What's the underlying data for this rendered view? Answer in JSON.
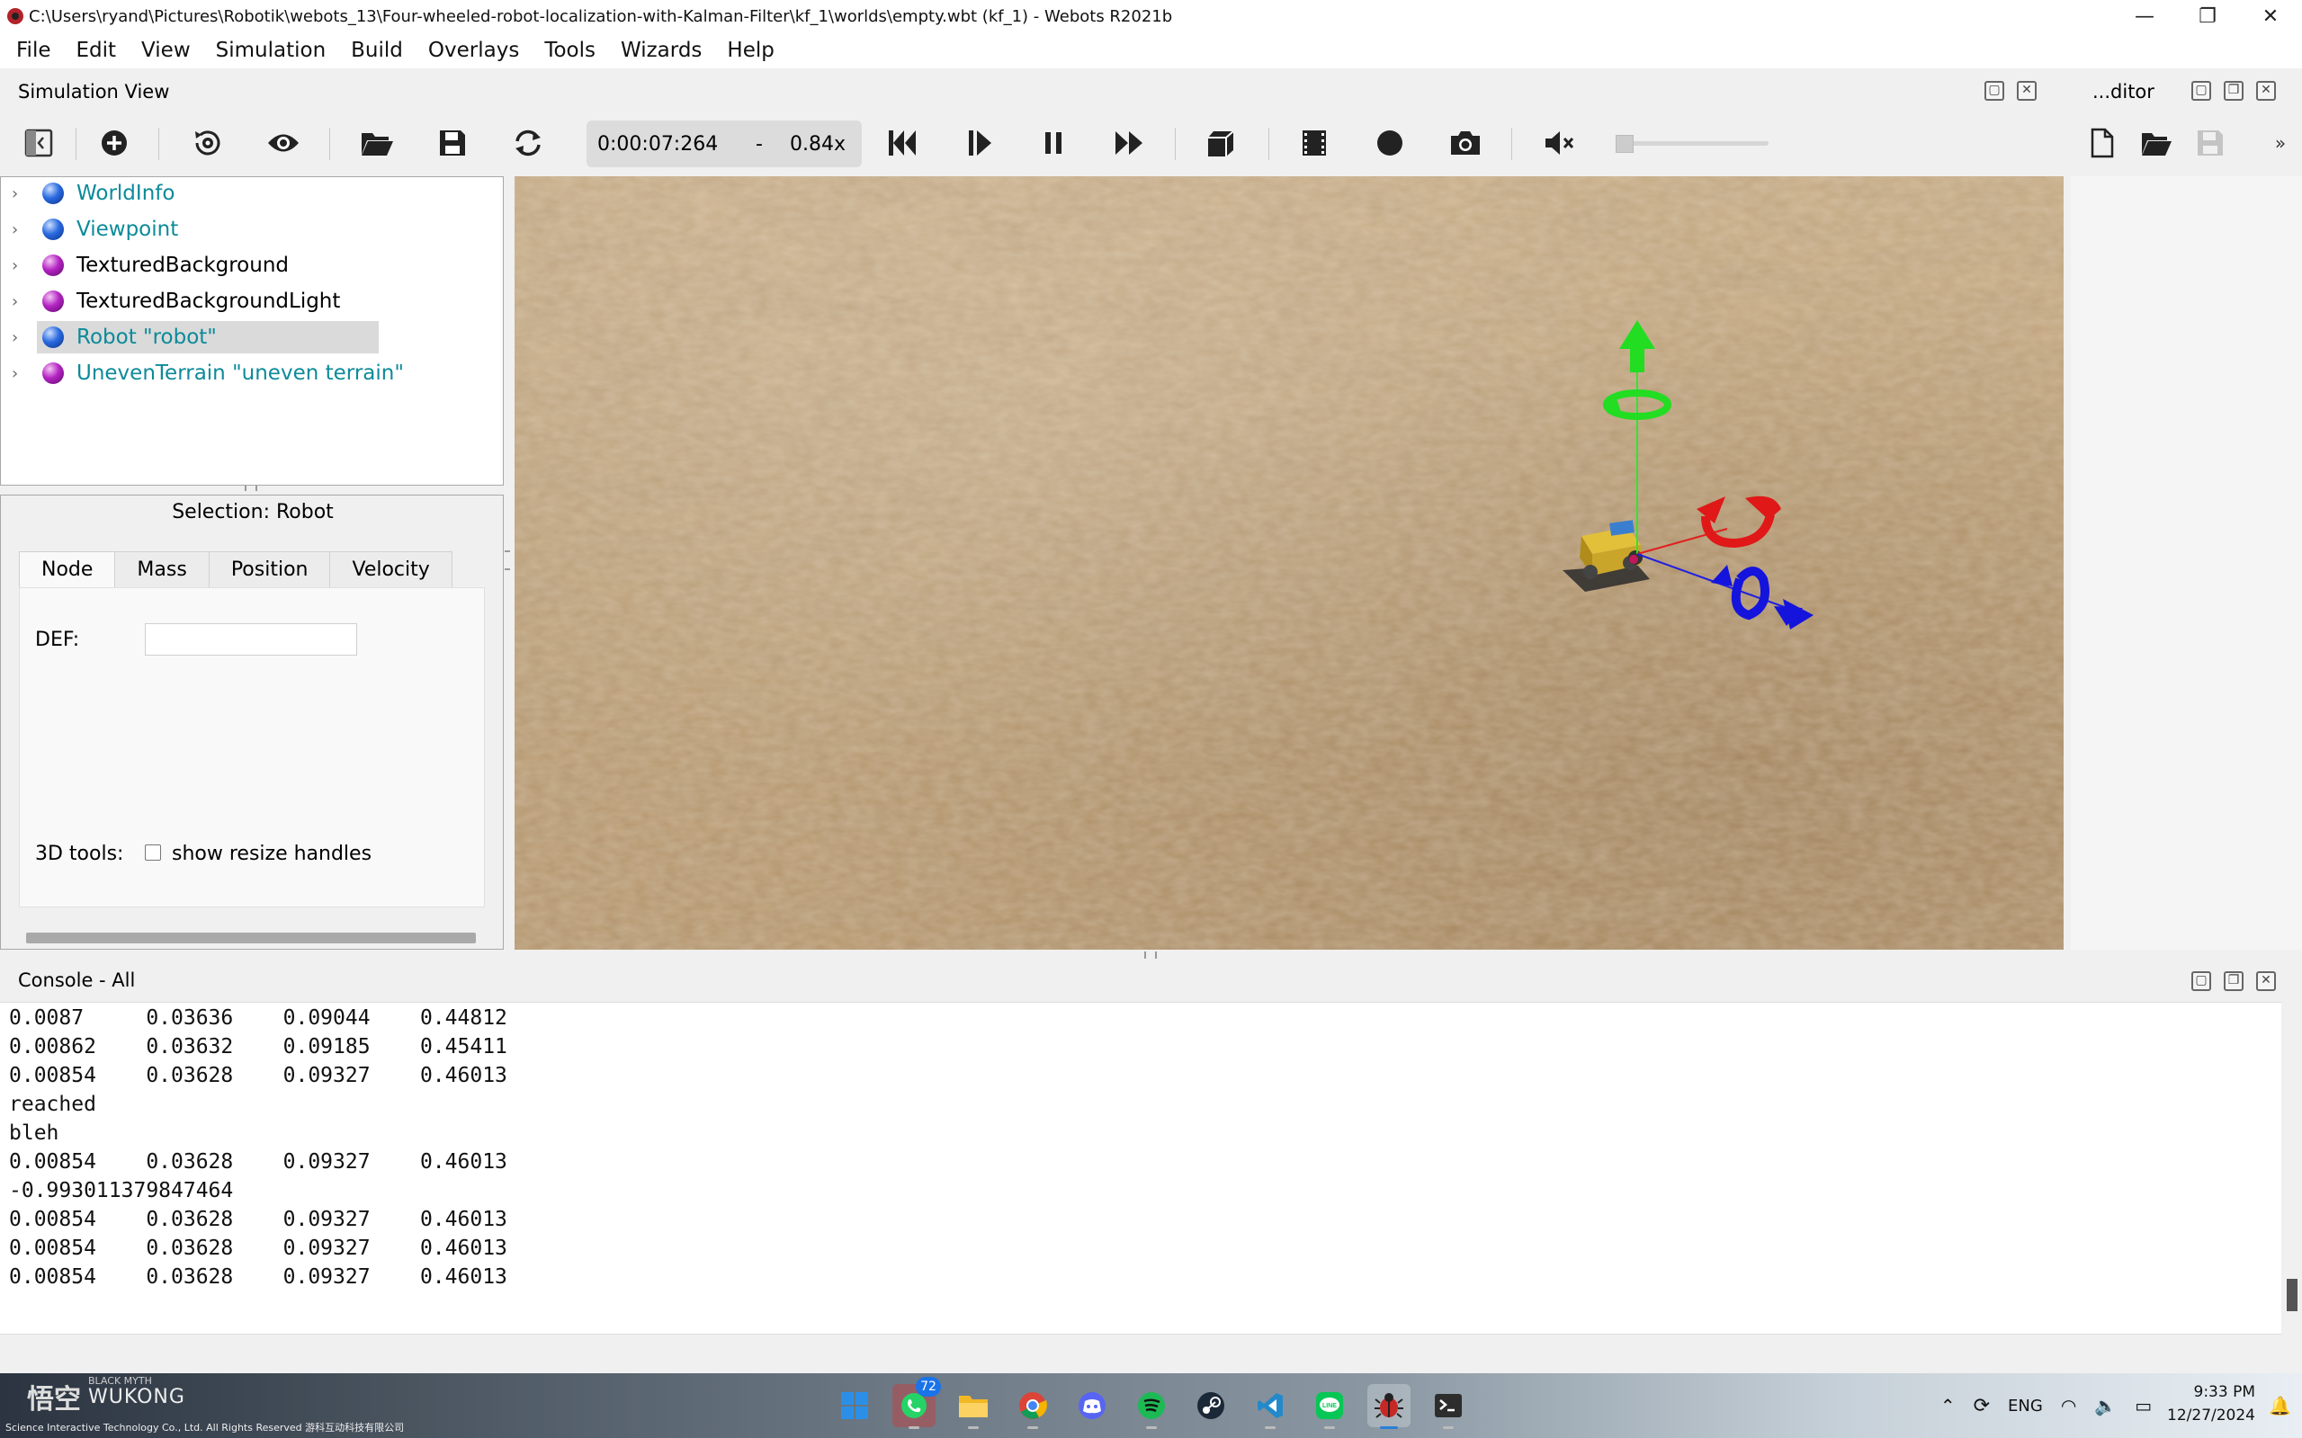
{
  "window": {
    "title": "C:\\Users\\ryand\\Pictures\\Robotik\\webots_13\\Four-wheeled-robot-localization-with-Kalman-Filter\\kf_1\\worlds\\empty.wbt (kf_1) - Webots R2021b",
    "min": "—",
    "max": "❐",
    "close": "✕"
  },
  "menu": [
    "File",
    "Edit",
    "View",
    "Simulation",
    "Build",
    "Overlays",
    "Tools",
    "Wizards",
    "Help"
  ],
  "sim_view": {
    "label": "Simulation View",
    "editor_label": "...ditor"
  },
  "toolbar": {
    "time": "0:00:07:264",
    "dash": "-",
    "speed": "0.84x",
    "volume_level": 0
  },
  "scene_tree": {
    "items": [
      {
        "label": "WorldInfo",
        "color": "blue",
        "teal": true
      },
      {
        "label": "Viewpoint",
        "color": "blue",
        "teal": true
      },
      {
        "label": "TexturedBackground",
        "color": "purple",
        "teal": false
      },
      {
        "label": "TexturedBackgroundLight",
        "color": "purple",
        "teal": false
      },
      {
        "label": "Robot \"robot\"",
        "color": "blue",
        "teal": true
      },
      {
        "label": "UnevenTerrain \"uneven terrain\"",
        "color": "purple",
        "teal": true
      }
    ],
    "selected_index": 4
  },
  "field_editor": {
    "selection": "Selection: Robot",
    "tabs": [
      "Node",
      "Mass",
      "Position",
      "Velocity"
    ],
    "active_tab": "Node",
    "def_label": "DEF:",
    "def_value": "",
    "tools_label": "3D tools:",
    "resize_label": "show resize handles",
    "resize_checked": false
  },
  "console": {
    "label": "Console - All",
    "lines": [
      "0.0087     0.03636    0.09044    0.44812",
      "0.00862    0.03632    0.09185    0.45411",
      "0.00854    0.03628    0.09327    0.46013",
      "reached",
      "bleh",
      "0.00854    0.03628    0.09327    0.46013",
      "-0.993011379847464",
      "0.00854    0.03628    0.09327    0.46013",
      "0.00854    0.03628    0.09327    0.46013",
      "0.00854    0.03628    0.09327    0.46013"
    ]
  },
  "taskbar": {
    "brand": "BLACK MYTH",
    "brand_name": "WUKONG",
    "copyright": "Science Interactive Technology Co., Ltd. All Rights Reserved 游科互动科技有限公司",
    "whatsapp_badge": "72",
    "lang": "ENG",
    "time": "9:33 PM",
    "date": "12/27/2024"
  }
}
